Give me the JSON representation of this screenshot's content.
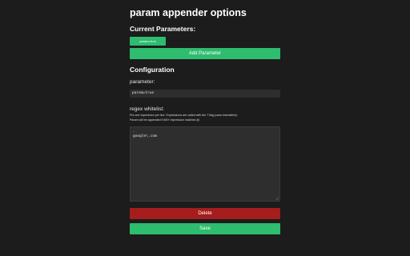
{
  "title": "param appender options",
  "current": {
    "heading": "Current Parameters:",
    "chips": [
      "param=true"
    ],
    "add_button": "Add Parameter"
  },
  "config": {
    "heading": "Configuration",
    "parameter_label": "parameter:",
    "parameter_value": "param=true",
    "regex_label": "regex whitelist:",
    "help_line1": "Put one expression per line. Expressions are called with the 'i' flag (case-insensitive).",
    "help_line2": "Param will be appended if ANY expression matches @.",
    "regex_lines": [
      ".",
      "google\\.com"
    ],
    "delete_button": "Delete",
    "save_button": "Save"
  }
}
